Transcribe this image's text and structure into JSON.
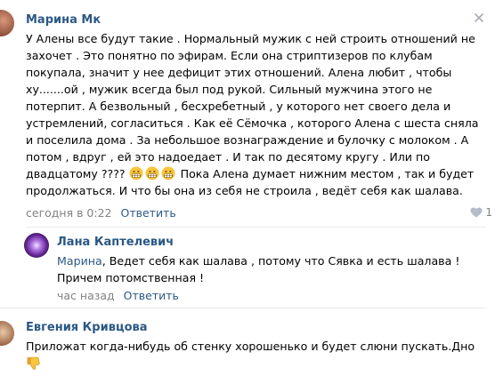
{
  "comments": [
    {
      "author": "Марина Мк",
      "lines": [
        "У Алены все будут такие . Нормальный мужик с ней строить отношений не",
        "захочет . Это понятно по эфирам. Если она стриптизеров по клубам",
        "покупала, значит у нее дефицит этих отношений. Алена любит , чтобы",
        "ху.......ой , мужик всегда был под рукой. Сильный мужчина этого не",
        "потерпит. А безвольный , бесхребетный , у которого нет своего дела и",
        "устремлений, согласиться . Как её Сёмочка , которого Алена с шеста сняла",
        "и поселила дома . За небольшое вознаграждение и булочку с молоком . А",
        "потом , вдруг , ей это надоедает . И так по десятому кругу . Или по"
      ],
      "line9_before": "двадцатому ????",
      "line9_after": "Пока Алена думает нижним местом , так и будет",
      "line10": "продолжаться. И что бы она из себя не строила , ведёт себя как шалава.",
      "time": "сегодня в 0:22",
      "reply_label": "Ответить",
      "likes": "1"
    },
    {
      "author": "Лана Каптелевич",
      "mention": "Марина",
      "text_line1": ", Ведет себя как шалава , потому что Сявка и есть шалава !",
      "text_line2": "Причем потомственная !",
      "time": "час назад",
      "reply_label": "Ответить"
    },
    {
      "author": "Евгения Кривцова",
      "text": "Приложат когда-нибудь об стенку хорошенько и будет слюни пускать.Дно"
    }
  ],
  "icons": {
    "close": "close-icon",
    "like": "heart-icon",
    "emoji_grin": "grinning-emoji",
    "emoji_thumbs_down": "thumbs-down-emoji"
  },
  "colors": {
    "link": "#2a5885",
    "meta": "#828282",
    "divider": "#e7e8ec"
  }
}
